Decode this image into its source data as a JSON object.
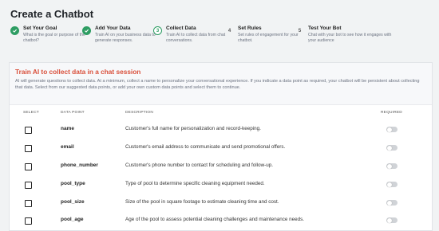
{
  "page_title": "Create a Chatbot",
  "steps": [
    {
      "title": "Set Your Goal",
      "desc": "What is the goal or purpose of the chatbot?",
      "state": "done",
      "marker": ""
    },
    {
      "title": "Add Your Data",
      "desc": "Train AI on your business data to generate responses.",
      "state": "done",
      "marker": ""
    },
    {
      "title": "Collect Data",
      "desc": "Train AI to collect data from chat conversations.",
      "state": "current",
      "marker": "3"
    },
    {
      "title": "Set Rules",
      "desc": "Set rules of engagement for your chatbot.",
      "state": "todo",
      "marker": "4"
    },
    {
      "title": "Test Your Bot",
      "desc": "Chat with your bot to see how it engages with your audience",
      "state": "todo",
      "marker": "5"
    }
  ],
  "section": {
    "title": "Train AI to collect data in a chat session",
    "description": "AI will generate questions to collect data. At a minimum, collect a name to personalize your conversational experience. If you indicate a data point as required, your chatbot will be persistent about collecting that data. Select from our suggested data points, or add your own custom data points and select them to continue."
  },
  "table": {
    "headers": {
      "select": "SELECT",
      "data_point": "DATA POINT",
      "description": "DESCRIPTION",
      "required": "REQUIRED"
    },
    "rows": [
      {
        "name": "name",
        "desc": "Customer's full name for personalization and record-keeping.",
        "selected": false,
        "required": false
      },
      {
        "name": "email",
        "desc": "Customer's email address to communicate and send promotional offers.",
        "selected": false,
        "required": false
      },
      {
        "name": "phone_number",
        "desc": "Customer's phone number to contact for scheduling and follow-up.",
        "selected": false,
        "required": false
      },
      {
        "name": "pool_type",
        "desc": "Type of pool to determine specific cleaning equipment needed.",
        "selected": false,
        "required": false
      },
      {
        "name": "pool_size",
        "desc": "Size of the pool in square footage to estimate cleaning time and cost.",
        "selected": false,
        "required": false
      },
      {
        "name": "pool_age",
        "desc": "Age of the pool to assess potential cleaning challenges and maintenance needs.",
        "selected": false,
        "required": false
      }
    ]
  },
  "colors": {
    "accent": "#2e9d63",
    "section_title": "#d94f3a",
    "toggle_off": "#d0d3d7"
  }
}
